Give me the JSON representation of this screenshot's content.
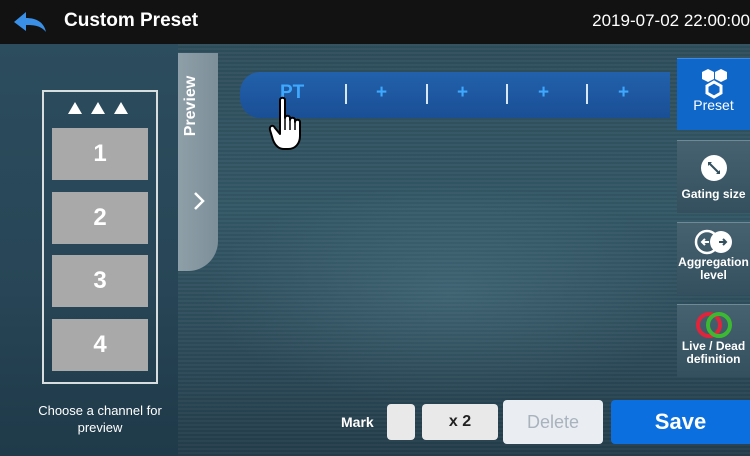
{
  "header": {
    "title": "Custom Preset",
    "datetime": "2019-07-02 22:00:00",
    "back_icon": "back-arrow-icon"
  },
  "channels": {
    "arrows_icon": "triple-up-arrow-icon",
    "items": [
      "1",
      "2",
      "3",
      "4"
    ],
    "hint": "Choose a channel for preview"
  },
  "preview_tab": {
    "label": "Preview",
    "chevron_icon": "chevron-right-icon"
  },
  "preset_bar": {
    "slots": [
      "PT",
      "+",
      "+",
      "+",
      "+"
    ]
  },
  "side_buttons": [
    {
      "label": "Preset",
      "icon": "hexagons-icon",
      "active": true
    },
    {
      "label": "Gating size",
      "icon": "resize-icon",
      "active": false
    },
    {
      "label": "Aggregation level",
      "icon": "aggregation-icon",
      "active": false
    },
    {
      "label": "Live / Dead definition",
      "icon": "overlapping-circles-icon",
      "active": false
    }
  ],
  "bottom": {
    "mark_label": "Mark",
    "multiplier_label": "x 2",
    "delete_label": "Delete",
    "save_label": "Save"
  },
  "colors": {
    "accent": "#0b6fe0",
    "preset_bar": "#1f59a2",
    "header_bg": "#121212"
  }
}
